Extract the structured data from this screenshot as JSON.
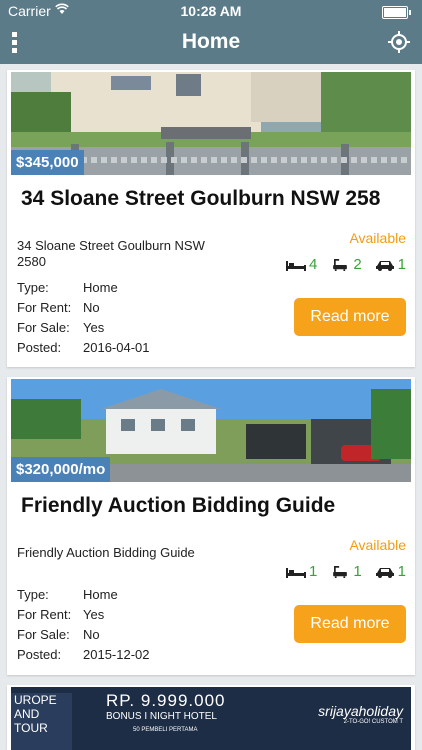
{
  "status": {
    "carrier": "Carrier",
    "time": "10:28 AM"
  },
  "nav": {
    "title": "Home"
  },
  "listings": [
    {
      "price": "$345,000",
      "headline": "34 Sloane Street Goulburn NSW 258",
      "address": "34 Sloane Street Goulburn NSW 2580",
      "availability": "Available",
      "beds": "4",
      "baths": "2",
      "cars": "1",
      "type_label": "Type:",
      "type": "Home",
      "rent_label": "For Rent:",
      "for_rent": "No",
      "sale_label": "For Sale:",
      "for_sale": "Yes",
      "posted_label": "Posted:",
      "posted": "2016-04-01",
      "button": "Read more"
    },
    {
      "price": "$320,000/mo",
      "headline": "Friendly Auction Bidding Guide",
      "address": "Friendly Auction Bidding Guide",
      "availability": "Available",
      "beds": "1",
      "baths": "1",
      "cars": "1",
      "type_label": "Type:",
      "type": "Home",
      "rent_label": "For Rent:",
      "for_rent": "Yes",
      "sale_label": "For Sale:",
      "for_sale": "No",
      "posted_label": "Posted:",
      "posted": "2015-12-02",
      "button": "Read more"
    }
  ],
  "ad": {
    "left_text": "UROPE AND TOUR",
    "price": "RP. 9.999.000",
    "bonus": "BONUS I NIGHT HOTEL",
    "sub": "50 PEMBELI PERTAMA",
    "brand": "srijayaholiday",
    "tagline": "2-TO-GO! CUSTOM T"
  },
  "icons": {
    "menu": "menu-icon",
    "locate": "crosshair-icon",
    "bed": "bed-icon",
    "bath": "bath-icon",
    "car": "car-icon"
  },
  "colors": {
    "nav": "#5c7b88",
    "price_tag": "#4a82b8",
    "accent": "#f7a21b",
    "amenity": "#3aa13a"
  }
}
